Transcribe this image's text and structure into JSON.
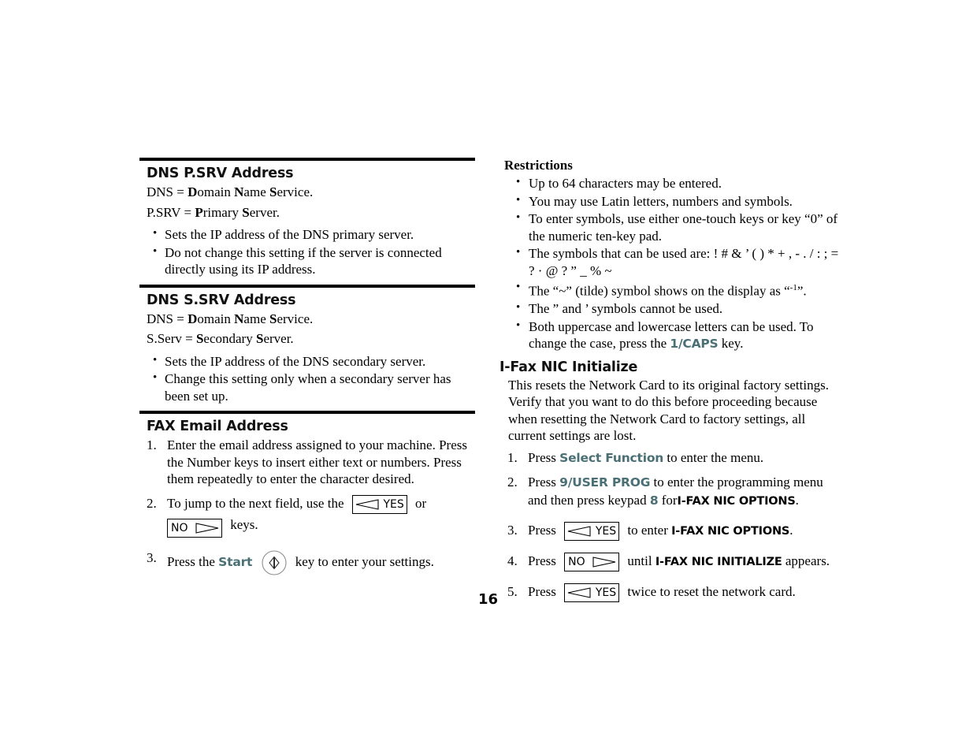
{
  "page": {
    "number": "16"
  },
  "left_column": {
    "sections": [
      {
        "heading": "DNS P.SRV Address",
        "def_line_1_prefix": "DNS = ",
        "def_line_1_b1": "D",
        "def_line_1_t1": "omain ",
        "def_line_1_b2": "N",
        "def_line_1_t2": "ame ",
        "def_line_1_b3": "S",
        "def_line_1_t3": "ervice.",
        "def_line_2_prefix": "P.SRV = ",
        "def_line_2_b1": "P",
        "def_line_2_t1": "rimary ",
        "def_line_2_b2": "S",
        "def_line_2_t2": "erver.",
        "bullets": [
          "Sets the IP address of the DNS primary server.",
          "Do not change this setting if the server is connected directly using its IP address."
        ]
      },
      {
        "heading": "DNS S.SRV Address",
        "def_line_1_prefix": "DNS = ",
        "def_line_1_b1": "D",
        "def_line_1_t1": "omain ",
        "def_line_1_b2": "N",
        "def_line_1_t2": "ame ",
        "def_line_1_b3": "S",
        "def_line_1_t3": "ervice.",
        "def_line_2_prefix": "S.Serv = ",
        "def_line_2_b1": "S",
        "def_line_2_t1": "econdary ",
        "def_line_2_b2": "S",
        "def_line_2_t2": "erver.",
        "bullets": [
          "Sets the IP address of the DNS secondary server.",
          "Change this setting only when a secondary server has been set up."
        ]
      }
    ],
    "fax_email": {
      "heading": "FAX Email Address",
      "step1_num": "1.",
      "step1_text": "Enter the email address assigned to your machine. Press the Number keys to insert either text or numbers.  Press them repeatedly to enter the character desired.",
      "step2_num": "2.",
      "step2_before": "To jump to the next field, use the",
      "step2_mid": "or",
      "step2_after": "keys.",
      "step3_num": "3.",
      "step3_before": "Press the",
      "step3_accent": "Start",
      "step3_after": "key to enter your settings."
    }
  },
  "right_column": {
    "restrictions": {
      "heading": "Restrictions",
      "bullets": [
        "Up to 64 characters may be entered.",
        "You may use Latin letters, numbers and symbols.",
        "To enter symbols, use either one-touch keys or key “0” of the numeric ten-key pad.",
        "The symbols that can be used are: ! # & ’ ( ) * + , - . / : ; = ? · @ ? ” _ % ~"
      ],
      "tilde_bullet_pre": "The “~” (tilde) symbol shows on the display as “",
      "tilde_bullet_sup": "-1",
      "tilde_bullet_post": "”.",
      "quote_bullet": "The ” and ’ symbols cannot be used.",
      "case_bullet_pre": "Both uppercase and lowercase letters can be used.  To change the case, press the",
      "case_bullet_accent": "1/CAPS",
      "case_bullet_post": "key."
    },
    "ifax": {
      "heading": "I-Fax NIC Initialize",
      "intro": "This resets the Network Card to its original factory settings. Verify that you want to do this before proceeding because when resetting the Network Card to factory settings, all current settings are lost.",
      "step1_num": "1.",
      "step1_before": "Press",
      "step1_accent": "Select Function",
      "step1_after": "to enter the menu.",
      "step2_num": "2.",
      "step2_before": "Press",
      "step2_accent": "9/USER PROG",
      "step2_mid": "to enter the programming menu and then press keypad",
      "step2_accent2": "8",
      "step2_mid2": "for",
      "step2_bold": "I-FAX NIC OPTIONS",
      "step2_after": ".",
      "step3_num": "3.",
      "step3_before": "Press",
      "step3_mid": "to enter",
      "step3_bold": "I-FAX NIC OPTIONS",
      "step3_after": ".",
      "step4_num": "4.",
      "step4_before": "Press",
      "step4_mid": "until",
      "step4_bold": "I-FAX NIC INITIALIZE",
      "step4_after": "appears.",
      "step5_num": "5.",
      "step5_before": "Press",
      "step5_after": "twice to reset the network card."
    }
  },
  "keys": {
    "yes_label": "YES",
    "no_label": "NO",
    "start_label": "Start"
  },
  "colors": {
    "accent_teal": "#4a7076",
    "rule_black": "#000000",
    "text_black": "#000000"
  }
}
